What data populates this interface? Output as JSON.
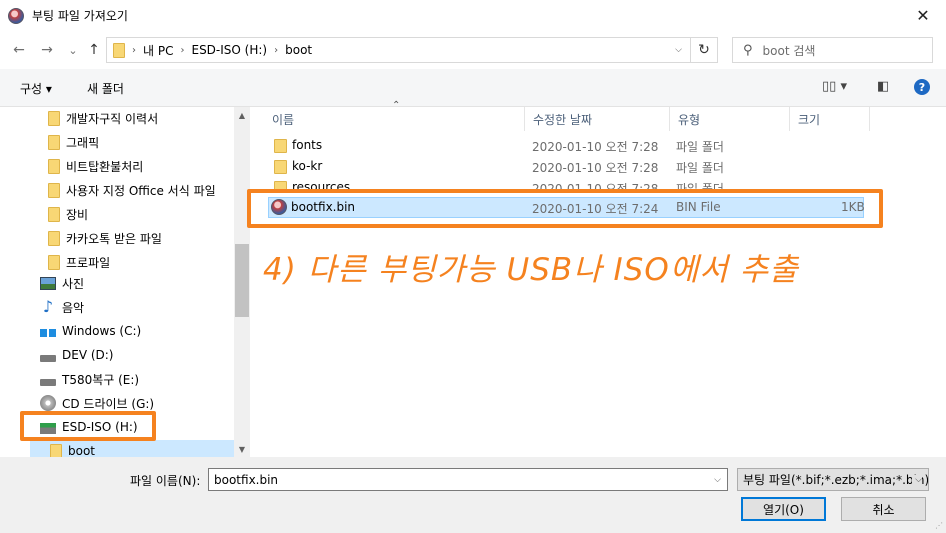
{
  "window": {
    "title": "부팅 파일 가져오기",
    "close_glyph": "✕"
  },
  "nav": {
    "back_glyph": "←",
    "forward_glyph": "→",
    "recent_glyph": "⌄",
    "up_glyph": "↑",
    "breadcrumb": [
      "내 PC",
      "ESD-ISO (H:)",
      "boot"
    ],
    "refresh_glyph": "↻",
    "search_placeholder": "boot 검색",
    "search_icon": "search-icon"
  },
  "toolbar": {
    "organize_label": "구성 ▾",
    "new_folder_label": "새 폴더",
    "view_glyph": "▯▯ ▾",
    "pane_glyph": "◧",
    "help_glyph": "?"
  },
  "tree": {
    "items": [
      {
        "label": "개발자구직 이력서",
        "icon": "folder-icon"
      },
      {
        "label": "그래픽",
        "icon": "folder-icon"
      },
      {
        "label": "비트탑환불처리",
        "icon": "folder-icon"
      },
      {
        "label": "사용자 지정 Office 서식 파일",
        "icon": "folder-icon"
      },
      {
        "label": "장비",
        "icon": "folder-icon"
      },
      {
        "label": "카카오톡 받은 파일",
        "icon": "folder-icon"
      },
      {
        "label": "프로파일",
        "icon": "folder-icon"
      },
      {
        "label": "사진",
        "icon": "pictures-icon"
      },
      {
        "label": "음악",
        "icon": "music-icon"
      },
      {
        "label": "Windows (C:)",
        "icon": "windows-drive-icon"
      },
      {
        "label": "DEV (D:)",
        "icon": "drive-icon"
      },
      {
        "label": "T580복구 (E:)",
        "icon": "drive-icon"
      },
      {
        "label": "CD 드라이브 (G:)",
        "icon": "cd-drive-icon"
      },
      {
        "label": "ESD-ISO (H:)",
        "icon": "usb-drive-icon"
      },
      {
        "label": "boot",
        "icon": "folder-icon"
      }
    ]
  },
  "columns": {
    "name": "이름",
    "date": "수정한 날짜",
    "type": "유형",
    "size": "크기"
  },
  "files": [
    {
      "name": "fonts",
      "date": "2020-01-10 오전 7:28",
      "type": "파일 폴더",
      "size": "",
      "icon": "folder-icon"
    },
    {
      "name": "ko-kr",
      "date": "2020-01-10 오전 7:28",
      "type": "파일 폴더",
      "size": "",
      "icon": "folder-icon"
    },
    {
      "name": "resources",
      "date": "2020-01-10 오전 7:28",
      "type": "파일 폴더",
      "size": "",
      "icon": "folder-icon"
    },
    {
      "name": "bootfix.bin",
      "date": "2020-01-10 오전 7:24",
      "type": "BIN File",
      "size": "1KB",
      "icon": "bin-file-icon"
    }
  ],
  "annotation": "4) 다른 부팅가능 USB나 ISO에서 추출",
  "bottom": {
    "filename_label": "파일 이름(N):",
    "filename_value": "bootfix.bin",
    "filetype_value": "부팅 파일(*.bif;*.ezb;*.ima;*.bin)",
    "open_label": "열기(O)",
    "cancel_label": "취소"
  },
  "colors": {
    "accent": "#0078d7",
    "highlight": "#f5821f",
    "selection": "#cce8ff"
  }
}
